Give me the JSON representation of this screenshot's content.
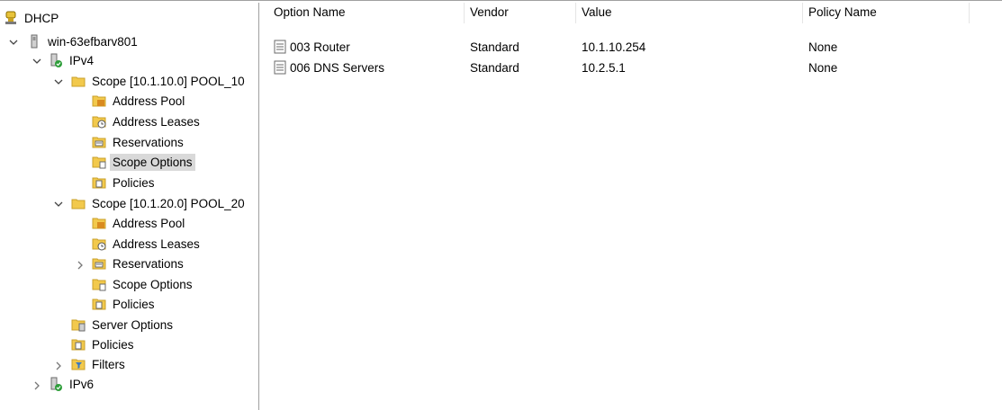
{
  "tree": {
    "root": {
      "label": "DHCP",
      "icon": "dhcp-icon"
    },
    "server": {
      "label": "win-63efbarv801",
      "icon": "server-icon"
    },
    "ipv4": {
      "label": "IPv4",
      "icon": "ipv4-icon"
    },
    "scope1": {
      "label": "Scope [10.1.10.0] POOL_10",
      "children": [
        "Address Pool",
        "Address Leases",
        "Reservations",
        "Scope Options",
        "Policies"
      ]
    },
    "scope2": {
      "label": "Scope [10.1.20.0] POOL_20",
      "children": [
        "Address Pool",
        "Address Leases",
        "Reservations",
        "Scope Options",
        "Policies"
      ]
    },
    "server_options": "Server Options",
    "policies": "Policies",
    "filters": "Filters",
    "ipv6": {
      "label": "IPv6",
      "icon": "ipv6-icon"
    },
    "selected": "Scope Options"
  },
  "list": {
    "columns": [
      "Option Name",
      "Vendor",
      "Value",
      "Policy Name"
    ],
    "rows": [
      {
        "option_name": "003 Router",
        "vendor": "Standard",
        "value": "10.1.10.254",
        "policy_name": "None"
      },
      {
        "option_name": "006 DNS Servers",
        "vendor": "Standard",
        "value": "10.2.5.1",
        "policy_name": "None"
      }
    ]
  },
  "colors": {
    "selection": "#d9d9d9",
    "folder": "#f2c94c",
    "divider": "#a0a0a0"
  }
}
